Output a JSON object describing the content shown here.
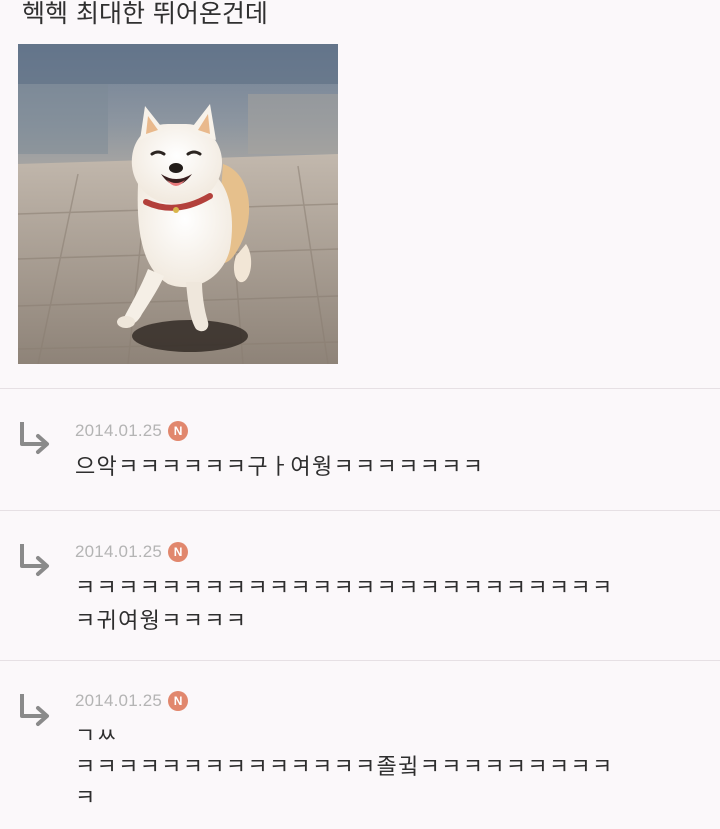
{
  "post": {
    "text": "헥헥 최대한 뛰어온건데"
  },
  "image": {
    "subject": "shiba-inu-running-photo"
  },
  "comments": [
    {
      "date": "2014.01.25",
      "badge": "N",
      "text": "으악ㅋㅋㅋㅋㅋㅋ구ㅏ여웡ㅋㅋㅋㅋㅋㅋㅋ"
    },
    {
      "date": "2014.01.25",
      "badge": "N",
      "text": "ㅋㅋㅋㅋㅋㅋㅋㅋㅋㅋㅋㅋㅋㅋㅋㅋㅋㅋㅋㅋㅋㅋㅋㅋㅋ\nㅋ귀여웡ㅋㅋㅋㅋ"
    },
    {
      "date": "2014.01.25",
      "badge": "N",
      "text": "ㄱㅆ\nㅋㅋㅋㅋㅋㅋㅋㅋㅋㅋㅋㅋㅋㅋ졸귘ㅋㅋㅋㅋㅋㅋㅋㅋㅋ\nㅋ"
    }
  ],
  "colors": {
    "background": "#fbf8fa",
    "badge": "#e1876d",
    "date": "#b4b4b4",
    "arrow": "#8a8a8a"
  },
  "icons": {
    "reply": "reply-arrow-icon",
    "new": "new-badge-icon"
  }
}
